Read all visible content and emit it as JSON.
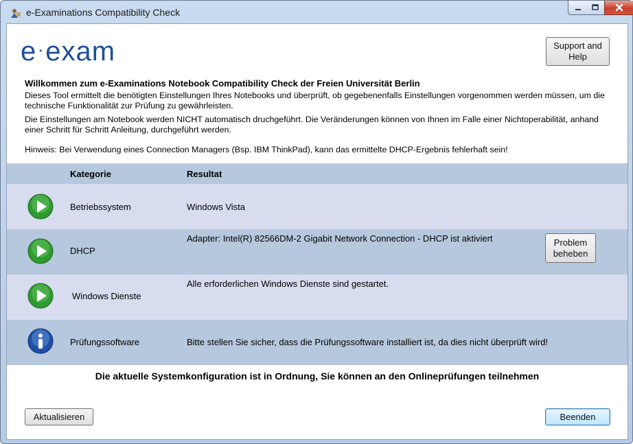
{
  "window": {
    "title": "e-Examinations Compatibility Check"
  },
  "header": {
    "logo_text": "e·exam",
    "support_button": "Support and Help"
  },
  "intro": {
    "heading": "Willkommen zum e-Examinations Notebook Compatibility Check der Freien Universität Berlin",
    "paragraph1": "Dieses Tool ermittelt die benötigten Einstellungen Ihres Notebooks und überprüft, ob gegebenenfalls Einstellungen vorgenommen werden müssen, um die technische Funktionalität zur Prüfung zu gewährleisten.",
    "paragraph2": "Die Einstellungen am Notebook werden NICHT automatisch druchgeführt. Die Veränderungen können von Ihnen im Falle einer Nichtoperabilität, anhand einer Schritt für Schritt Anleitung, durchgeführt werden.",
    "hint": "Hinweis: Bei Verwendung eines Connection Managers (Bsp. IBM ThinkPad), kann das ermittelte DHCP-Ergebnis fehlerhaft sein!"
  },
  "table": {
    "headers": {
      "category": "Kategorie",
      "result": "Resultat"
    },
    "rows": [
      {
        "icon": "play-icon",
        "category": "Betriebssystem",
        "result": "Windows Vista"
      },
      {
        "icon": "play-icon",
        "category": "DHCP",
        "result": "Adapter: Intel(R) 82566DM-2 Gigabit Network Connection - DHCP ist aktiviert",
        "action": "Problem beheben"
      },
      {
        "icon": "play-icon",
        "category": "Windows Dienste",
        "result": "Alle erforderlichen Windows Dienste sind gestartet."
      },
      {
        "icon": "info-icon",
        "category": "Prüfungssoftware",
        "result": "Bitte stellen Sie sicher, dass die Prüfungssoftware installiert ist, da dies nicht überprüft wird!"
      }
    ]
  },
  "status_message": "Die aktuelle Systemkonfiguration ist in Ordnung, Sie können an den Onlineprüfungen teilnehmen",
  "footer": {
    "refresh_button": "Aktualisieren",
    "exit_button": "Beenden"
  },
  "colors": {
    "header_row": "#b6c8dd",
    "light_row": "#d7dcee",
    "ok_green": "#2f9a2f",
    "info_blue": "#1f4fa8"
  }
}
